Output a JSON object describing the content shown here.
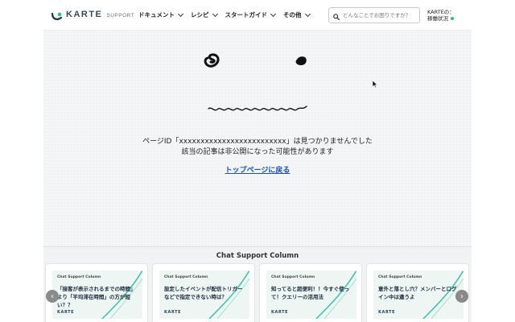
{
  "header": {
    "logo_text": "KARTE",
    "logo_sub": "SUPPORT",
    "nav": [
      {
        "label": "ドキュメント"
      },
      {
        "label": "レシピ"
      },
      {
        "label": "スタートガイド"
      },
      {
        "label": "その他"
      }
    ],
    "search_placeholder": "どんなことでお困りですか？",
    "status_line1": "KARTEの：",
    "status_line2": "稼働状況"
  },
  "main": {
    "message_line1": "ページID「xxxxxxxxxxxxxxxxxxxxxxxxx」は見つかりませんでした",
    "message_line2": "該当の記事は非公開になった可能性があります",
    "top_link": "トップページに戻る"
  },
  "column": {
    "title": "Chat Support Column",
    "cards": [
      {
        "tag": "Chat Support Column",
        "title": "「接客が表示されるまでの時間」より「平均滞在時間」の方が短い？？",
        "brand": "KARTE"
      },
      {
        "tag": "Chat Support Column",
        "title": "設定したイベントが配信トリガーなどで指定できない時は？",
        "brand": "KARTE"
      },
      {
        "tag": "Chat Support Column",
        "title": "知ってると超便利！！今すぐ使って！クエリーの活用法",
        "brand": "KARTE"
      },
      {
        "tag": "Chat Support Column",
        "title": "意外と落とし穴？メンバーとログイン中は違うよ",
        "brand": "KARTE"
      }
    ],
    "prev_label": "‹",
    "next_label": "›"
  },
  "colors": {
    "accent": "#2bbf7a",
    "link": "#1a4fd0"
  }
}
